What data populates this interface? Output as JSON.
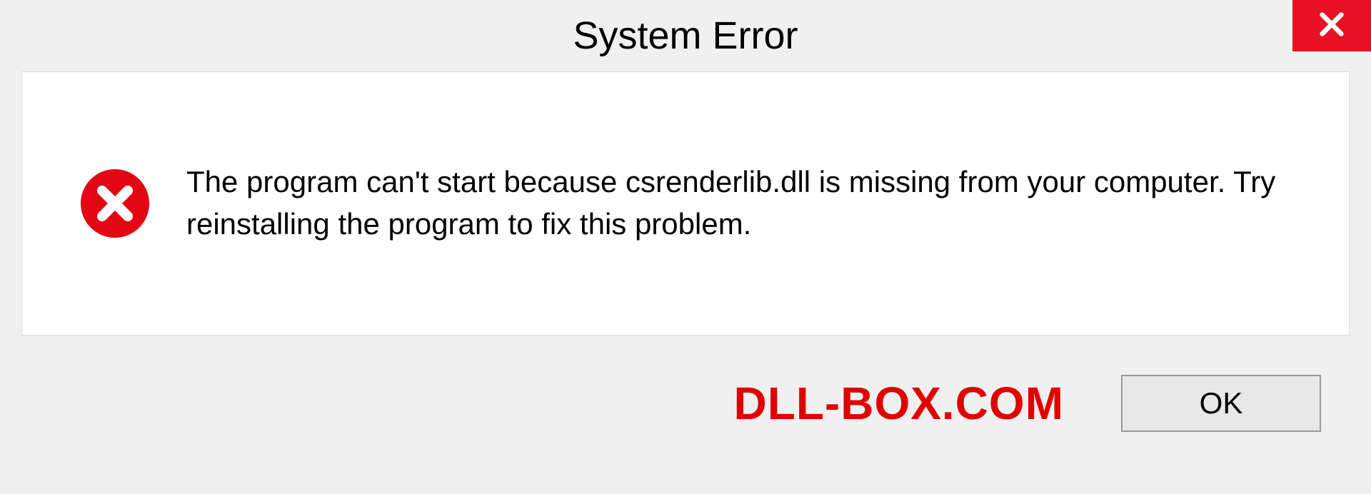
{
  "dialog": {
    "title": "System Error",
    "message": "The program can't start because csrenderlib.dll is missing from your computer. Try reinstalling the program to fix this problem.",
    "ok_label": "OK",
    "brand": "DLL-BOX.COM"
  },
  "colors": {
    "close_bg": "#e81123",
    "error_icon": "#e30613",
    "brand_text": "#e00000"
  }
}
